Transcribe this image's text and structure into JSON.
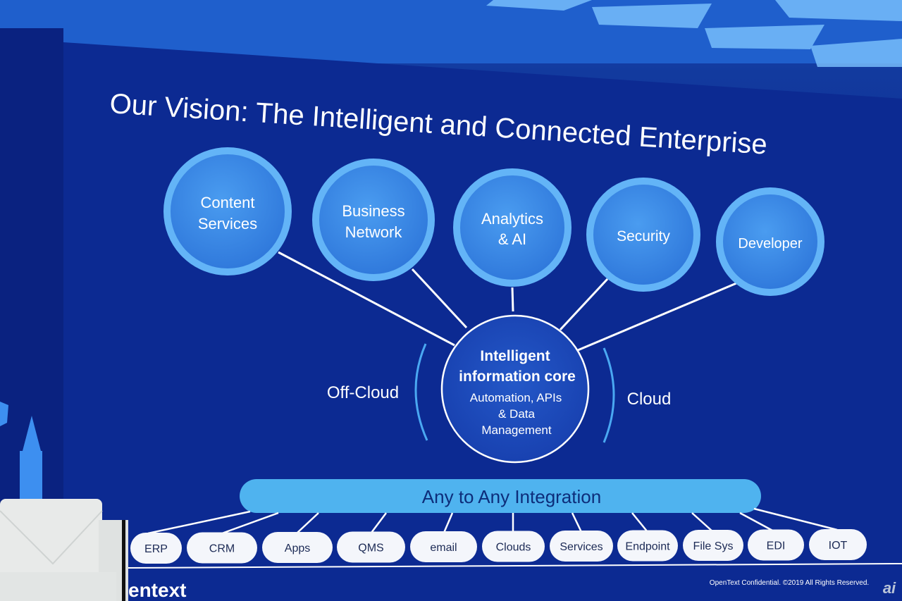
{
  "slide": {
    "title": "Our Vision: The Intelligent and Connected Enterprise",
    "pillars": [
      {
        "lines": [
          "Content",
          "Services"
        ]
      },
      {
        "lines": [
          "Business",
          "Network"
        ]
      },
      {
        "lines": [
          "Analytics",
          "& AI"
        ]
      },
      {
        "lines": [
          "Security"
        ]
      },
      {
        "lines": [
          "Developer"
        ]
      }
    ],
    "core": {
      "title_lines": [
        "Intelligent",
        "information core"
      ],
      "sub_lines": [
        "Automation, APIs",
        "& Data",
        "Management"
      ]
    },
    "left_label": "Off-Cloud",
    "right_label": "Cloud",
    "integration_bar": "Any to Any Integration",
    "systems": [
      "ERP",
      "CRM",
      "Apps",
      "QMS",
      "email",
      "Clouds",
      "Services",
      "Endpoint",
      "File Sys",
      "EDI",
      "IOT"
    ],
    "logo": "entext",
    "footer": "OpenText Confidential. ©2019 All Rights Reserved.",
    "watermark": "ai"
  },
  "colors": {
    "slide_bg": "#0d2c94",
    "circle_fill": "#3b8be6",
    "circle_ring": "#5fb0f5",
    "core_fill": "#1a45b8",
    "bar_fill": "#4fb3ef",
    "pill_fill": "#f4f6fb"
  }
}
